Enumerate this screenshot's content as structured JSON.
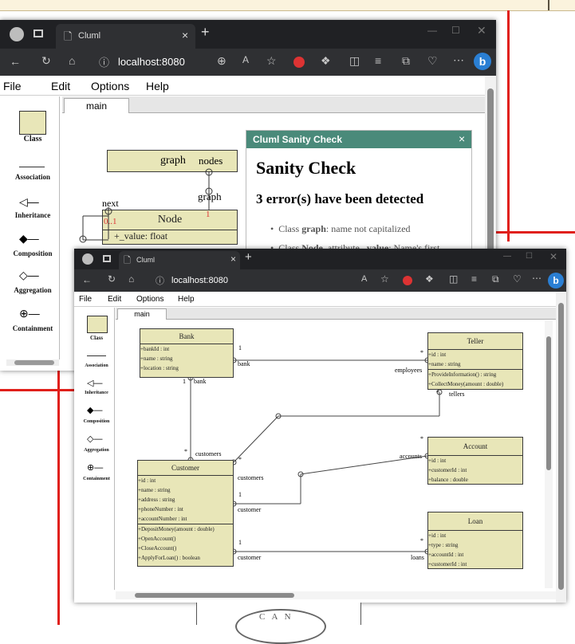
{
  "colors": {
    "accent_red": "#e0201b",
    "uml_fill": "#e8e6b8",
    "dialog_header": "#4a8a7a",
    "browser_dark": "#202124"
  },
  "back_window": {
    "tab_title": "Cluml",
    "url": "localhost:8080",
    "menu": [
      "File",
      "Edit",
      "Options",
      "Help"
    ],
    "doc_tab": "main",
    "palette": [
      "Class",
      "Association",
      "Inheritance",
      "Composition",
      "Aggregation",
      "Containment"
    ],
    "graph_class": {
      "name": "graph",
      "label_nodes": "nodes",
      "label_graph": "graph"
    },
    "node_class": {
      "name": "Node",
      "attr": "+_value: float",
      "label_next": "next",
      "mult_left": "0..1",
      "mult_right": "1"
    },
    "dialog": {
      "header": "Cluml Sanity Check",
      "close": "×",
      "title": "Sanity Check",
      "subtitle": "3 error(s) have been detected",
      "items": [
        {
          "pre": "Class ",
          "bold": "graph",
          "post": ": name not capitalized"
        },
        {
          "pre": "Class ",
          "bold": "Node",
          "post": ", attribute ",
          "bold2": "_value",
          "post2": ": Name's first"
        }
      ]
    }
  },
  "front_window": {
    "tab_title": "Cluml",
    "url": "localhost:8080",
    "menu": [
      "File",
      "Edit",
      "Options",
      "Help"
    ],
    "doc_tab": "main",
    "palette": [
      "Class",
      "Association",
      "Inheritance",
      "Composition",
      "Aggregation",
      "Containment"
    ],
    "classes": {
      "bank": {
        "name": "Bank",
        "rows": [
          "+bankId : int",
          "+name : string",
          "+location : string"
        ]
      },
      "teller": {
        "name": "Teller",
        "rows": [
          "+id : int",
          "+name : string"
        ],
        "ops": [
          "+ProvideInformation() : string",
          "+CollectMoney(amount : double)"
        ]
      },
      "account": {
        "name": "Account",
        "rows": [
          "+id : int",
          "+customerId : int",
          "+balance : double"
        ]
      },
      "customer": {
        "name": "Customer",
        "rows": [
          "+id : int",
          "+name : string",
          "+address : string",
          "+phoneNumber : int",
          "+accountNumber : int"
        ],
        "ops": [
          "+DepositMoney(amount : double)",
          "+OpenAccount()",
          "+CloseAccount()",
          "+ApplyForLoan() : boolean"
        ]
      },
      "loan": {
        "name": "Loan",
        "rows": [
          "+id : int",
          "+type : string",
          "+accountId : int",
          "+customerId : int"
        ]
      }
    },
    "labels": {
      "bank_mult_1": "1",
      "bank_role": "bank",
      "bank_mult_1b": "1",
      "bank_role_b": "bank",
      "teller_star": "*",
      "employees": "employees",
      "tellers": "tellers",
      "teller_star2": "*",
      "customers_star": "*",
      "customers": "customers",
      "customers2": "customers",
      "cust_star2": "*",
      "acc_star": "*",
      "accounts": "accounts",
      "cust_1": "1",
      "customer": "customer",
      "cust_1b": "1",
      "customer_b": "customer",
      "loans_star": "*",
      "loans": "loans"
    }
  },
  "bottom_text": "C A N"
}
